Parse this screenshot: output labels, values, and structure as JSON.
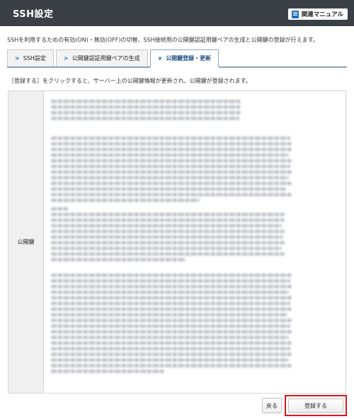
{
  "header": {
    "title": "SSH設定",
    "manual_label": "関連マニュアル"
  },
  "description": "SSHを利用するための有効(ON)・無効(OFF)の切替、SSH接続用の公開鍵認証用鍵ペアの生成と公開鍵の登録が行えます。",
  "tabs": [
    {
      "label": "SSH設定",
      "icon": "chevron-right-icon",
      "active": false
    },
    {
      "label": "公開鍵認証用鍵ペアの生成",
      "icon": "chevron-right-icon",
      "active": false
    },
    {
      "label": "公開鍵登録・更新",
      "icon": "chevron-down-icon",
      "active": true
    }
  ],
  "notice": "［登録する］をクリックすると、サーバー上の公開鍵情報が更新され、公開鍵が登録されます。",
  "form": {
    "public_key_label": "公開鍵"
  },
  "buttons": {
    "back_label": "戻る",
    "register_label": "登録する"
  },
  "colors": {
    "header_bg": "#3b4046",
    "highlight": "#e0151b",
    "tab_accent": "#1f6fb8"
  }
}
